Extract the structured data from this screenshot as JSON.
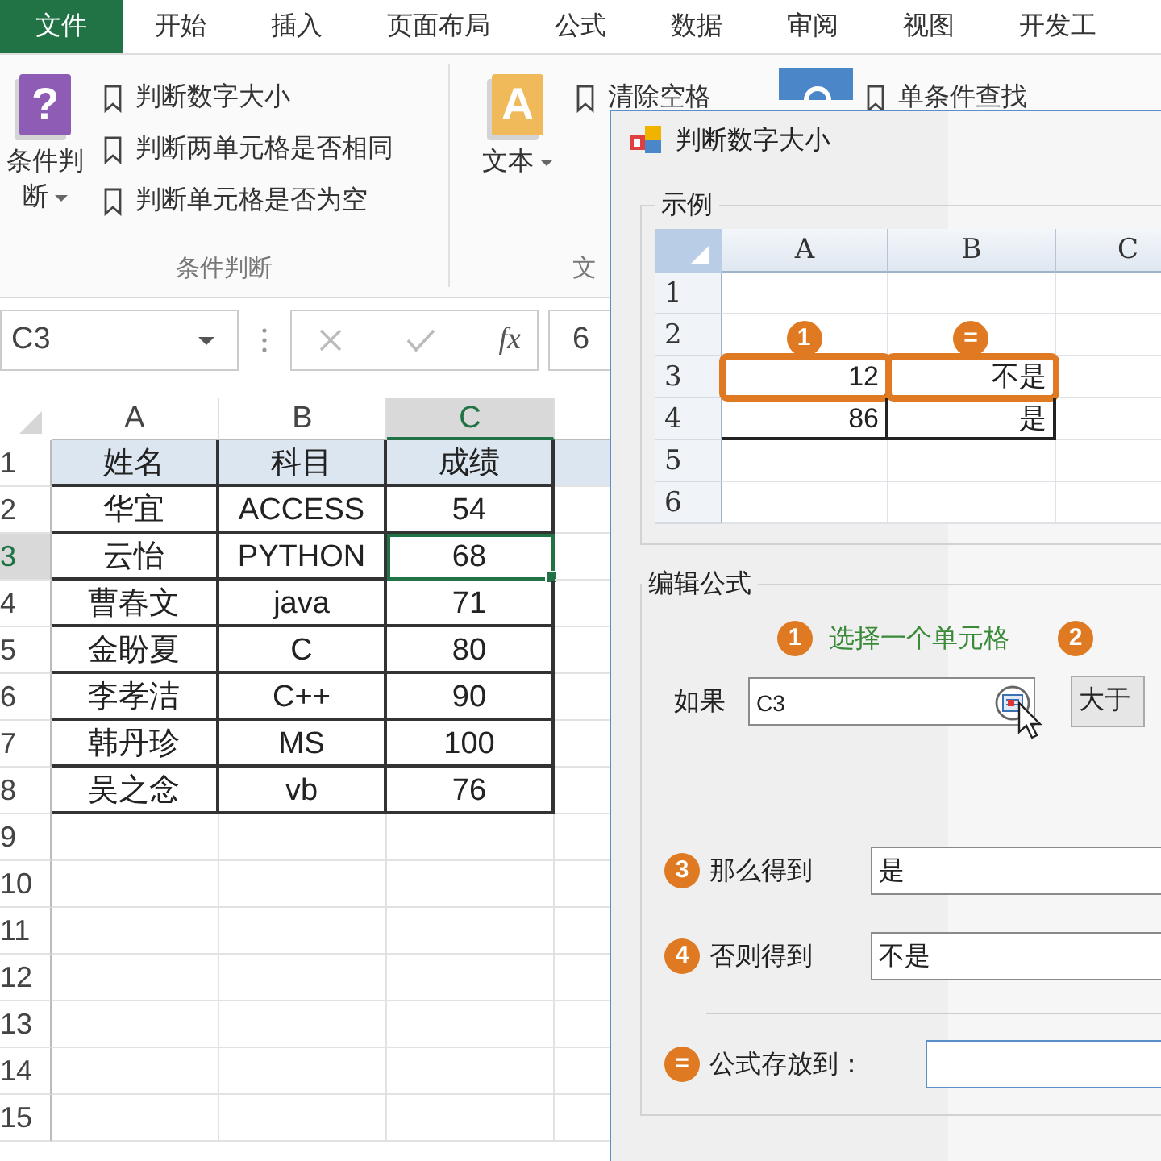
{
  "menu_tabs": [
    {
      "label": "文件",
      "selected": true
    },
    {
      "label": "开始",
      "selected": false
    },
    {
      "label": "插入",
      "selected": false
    },
    {
      "label": "页面布局",
      "selected": false
    },
    {
      "label": "公式",
      "selected": false
    },
    {
      "label": "数据",
      "selected": false
    },
    {
      "label": "审阅",
      "selected": false
    },
    {
      "label": "视图",
      "selected": false
    },
    {
      "label": "开发工",
      "selected": false
    }
  ],
  "ribbon": {
    "groups": [
      {
        "button": {
          "label": "条件判断",
          "icon_glyph": "?",
          "kind": "question",
          "dropdown": true
        },
        "items": [
          "判断数字大小",
          "判断两单元格是否相同",
          "判断单元格是否为空"
        ],
        "label": "条件判断"
      },
      {
        "button": {
          "label": "文本",
          "icon_glyph": "A",
          "kind": "letter",
          "dropdown": true
        },
        "items": [
          "清除空格"
        ],
        "label": "文"
      },
      {
        "button": {
          "kind": "lookup",
          "dropdown": false
        },
        "items": [
          "单条件查找"
        ]
      }
    ]
  },
  "formula_bar": {
    "name_box": "C3",
    "function_label": "fx",
    "formula": "6"
  },
  "sheet": {
    "columns": [
      {
        "label": "A",
        "selected": false
      },
      {
        "label": "B",
        "selected": false
      },
      {
        "label": "C",
        "selected": true
      }
    ],
    "rows": [
      {
        "number": "1",
        "selected": false,
        "kind": "header",
        "cells": [
          {
            "text": "姓名",
            "selected": false
          },
          {
            "text": "科目",
            "selected": false
          },
          {
            "text": "成绩",
            "selected": false
          }
        ]
      },
      {
        "number": "2",
        "selected": false,
        "kind": "data",
        "cells": [
          {
            "text": "华宜",
            "selected": false
          },
          {
            "text": "ACCESS",
            "selected": false
          },
          {
            "text": "54",
            "selected": false
          }
        ]
      },
      {
        "number": "3",
        "selected": true,
        "kind": "data",
        "cells": [
          {
            "text": "云怡",
            "selected": false
          },
          {
            "text": "PYTHON",
            "selected": false
          },
          {
            "text": "68",
            "selected": true
          }
        ]
      },
      {
        "number": "4",
        "selected": false,
        "kind": "data",
        "cells": [
          {
            "text": "曹春文",
            "selected": false
          },
          {
            "text": "java",
            "selected": false
          },
          {
            "text": "71",
            "selected": false
          }
        ]
      },
      {
        "number": "5",
        "selected": false,
        "kind": "data",
        "cells": [
          {
            "text": "金盼夏",
            "selected": false
          },
          {
            "text": "C",
            "selected": false
          },
          {
            "text": "80",
            "selected": false
          }
        ]
      },
      {
        "number": "6",
        "selected": false,
        "kind": "data",
        "cells": [
          {
            "text": "李孝洁",
            "selected": false
          },
          {
            "text": "C++",
            "selected": false
          },
          {
            "text": "90",
            "selected": false
          }
        ]
      },
      {
        "number": "7",
        "selected": false,
        "kind": "data",
        "cells": [
          {
            "text": "韩丹珍",
            "selected": false
          },
          {
            "text": "MS",
            "selected": false
          },
          {
            "text": "100",
            "selected": false
          }
        ]
      },
      {
        "number": "8",
        "selected": false,
        "kind": "data",
        "cells": [
          {
            "text": "吴之念",
            "selected": false
          },
          {
            "text": "vb",
            "selected": false
          },
          {
            "text": "76",
            "selected": false
          }
        ]
      },
      {
        "number": "9",
        "selected": false,
        "kind": "empty"
      },
      {
        "number": "10",
        "selected": false,
        "kind": "empty"
      },
      {
        "number": "11",
        "selected": false,
        "kind": "empty"
      },
      {
        "number": "12",
        "selected": false,
        "kind": "empty"
      },
      {
        "number": "13",
        "selected": false,
        "kind": "empty"
      },
      {
        "number": "14",
        "selected": false,
        "kind": "empty"
      },
      {
        "number": "15",
        "selected": false,
        "kind": "empty"
      }
    ]
  },
  "dialog": {
    "title": "判断数字大小",
    "example": {
      "label": "示例",
      "columns": [
        "A",
        "B",
        "C"
      ],
      "rows": [
        {
          "number": "1"
        },
        {
          "number": "2"
        },
        {
          "number": "3",
          "cells": [
            {
              "text": "12",
              "badge": "1"
            },
            {
              "text": "不是",
              "badge": "="
            }
          ]
        },
        {
          "number": "4",
          "cells": [
            {
              "text": "86"
            },
            {
              "text": "是"
            }
          ]
        },
        {
          "number": "5"
        },
        {
          "number": "6"
        }
      ]
    },
    "formula": {
      "label": "编辑公式",
      "steps": [
        {
          "badge": "1",
          "hint": "选择一个单元格"
        },
        {
          "badge": "2"
        }
      ],
      "condition": {
        "label": "如果",
        "value": "C3",
        "operator": "大于"
      },
      "then": {
        "badge": "3",
        "label": "那么得到",
        "value": "是"
      },
      "else": {
        "badge": "4",
        "label": "否则得到",
        "value": "不是"
      },
      "target": {
        "badge": "=",
        "label": "公式存放到："
      }
    }
  }
}
